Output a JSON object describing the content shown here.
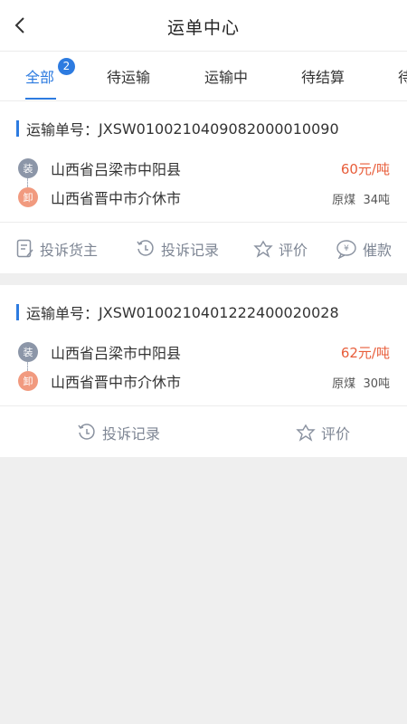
{
  "header": {
    "title": "运单中心",
    "back_icon": "chevron-left-icon"
  },
  "tabs": [
    {
      "label": "全部",
      "badge": "2",
      "active": true
    },
    {
      "label": "待运输"
    },
    {
      "label": "运输中"
    },
    {
      "label": "待结算"
    },
    {
      "label": "待"
    }
  ],
  "orders": [
    {
      "number_label": "运输单号：",
      "number": "JXSW010021040908200001009",
      "number_tail": "0",
      "load_tag": "装",
      "load_location": "山西省吕梁市中阳县",
      "unload_tag": "卸",
      "unload_location": "山西省晋中市介休市",
      "price": "60元/吨",
      "goods": "原煤",
      "weight": "34吨",
      "actions": [
        "投诉货主",
        "投诉记录",
        "评价",
        "催款"
      ]
    },
    {
      "number_label": "运输单号：",
      "number": "JXSW010021040122240002002",
      "number_tail": "8",
      "load_tag": "装",
      "load_location": "山西省吕梁市中阳县",
      "unload_tag": "卸",
      "unload_location": "山西省晋中市介休市",
      "price": "62元/吨",
      "goods": "原煤",
      "weight": "30吨",
      "actions": [
        "投诉记录",
        "评价"
      ]
    }
  ],
  "colors": {
    "accent": "#2d7be0",
    "price": "#e85d3a",
    "load_dot": "#8c96a8",
    "unload_dot": "#f19a7f",
    "background": "#efefef"
  }
}
